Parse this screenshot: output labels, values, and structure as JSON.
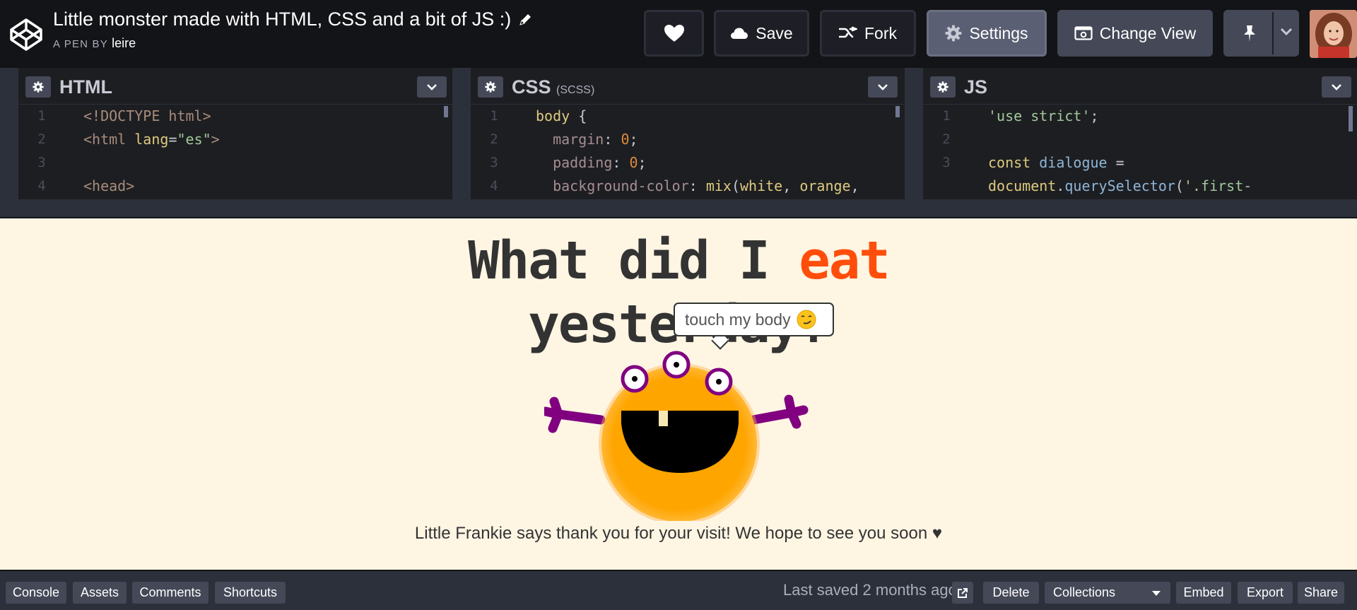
{
  "header": {
    "title": "Little monster made with HTML, CSS and a bit of JS :)",
    "pen_by": "A PEN BY",
    "author": "leire",
    "buttons": {
      "save": "Save",
      "fork": "Fork",
      "settings": "Settings",
      "change_view": "Change View"
    }
  },
  "editors": {
    "html": {
      "title": "HTML",
      "lines": [
        {
          "n": "1",
          "html": "<span class='c-tag'>&lt;!DOCTYPE html&gt;</span>"
        },
        {
          "n": "2",
          "html": "<span class='c-tag'>&lt;html</span> <span class='c-kw'>lang</span><span class='c-plain'>=</span><span class='c-str'>\"es\"</span><span class='c-tag'>&gt;</span>"
        },
        {
          "n": "3",
          "html": ""
        },
        {
          "n": "4",
          "html": "<span class='c-tag'>&lt;head&gt;</span>"
        }
      ]
    },
    "css": {
      "title": "CSS",
      "subtitle": "(SCSS)",
      "lines": [
        {
          "n": "1",
          "html": "<span class='c-sel'>body</span> <span class='c-plain'>{</span>"
        },
        {
          "n": "2",
          "html": "&nbsp;&nbsp;<span class='c-prop'>margin</span><span class='c-plain'>: </span><span class='c-num'>0</span><span class='c-plain'>;</span>"
        },
        {
          "n": "3",
          "html": "&nbsp;&nbsp;<span class='c-prop'>padding</span><span class='c-plain'>: </span><span class='c-num'>0</span><span class='c-plain'>;</span>"
        },
        {
          "n": "4",
          "html": "&nbsp;&nbsp;<span class='c-prop'>background-color</span><span class='c-plain'>: </span><span class='c-fn'>mix</span><span class='c-plain'>(</span><span class='c-kw'>white</span><span class='c-plain'>, </span><span class='c-kw'>orange</span><span class='c-plain'>,</span>"
        }
      ]
    },
    "js": {
      "title": "JS",
      "lines": [
        {
          "n": "1",
          "html": "<span class='c-str'>'use strict'</span><span class='c-plain'>;</span>"
        },
        {
          "n": "2",
          "html": ""
        },
        {
          "n": "3",
          "html": "<span class='c-kw'>const</span> <span class='c-var'>dialogue</span> <span class='c-plain'>=</span>"
        },
        {
          "n": "",
          "html": "<span class='c-kw'>document</span><span class='c-plain'>.</span><span class='c-var'>querySelector</span><span class='c-plain'>(</span><span class='c-str'>'.first-</span>"
        }
      ]
    }
  },
  "preview": {
    "headline_line1_prefix": "What did I ",
    "headline_accent": "eat",
    "headline_line2": "yesterday?",
    "bubble_text": "touch my body",
    "footer_message": "Little Frankie says thank you for your visit! We hope to see you soon ♥",
    "colors": {
      "accent": "#ff4e0b",
      "monster_body": "#ffa500",
      "monster_arms": "#800080"
    }
  },
  "bottombar": {
    "console": "Console",
    "assets": "Assets",
    "comments": "Comments",
    "shortcuts": "Shortcuts",
    "last_saved": "Last saved 2 months ago",
    "delete": "Delete",
    "collections": "Collections",
    "embed": "Embed",
    "export": "Export",
    "share": "Share"
  }
}
